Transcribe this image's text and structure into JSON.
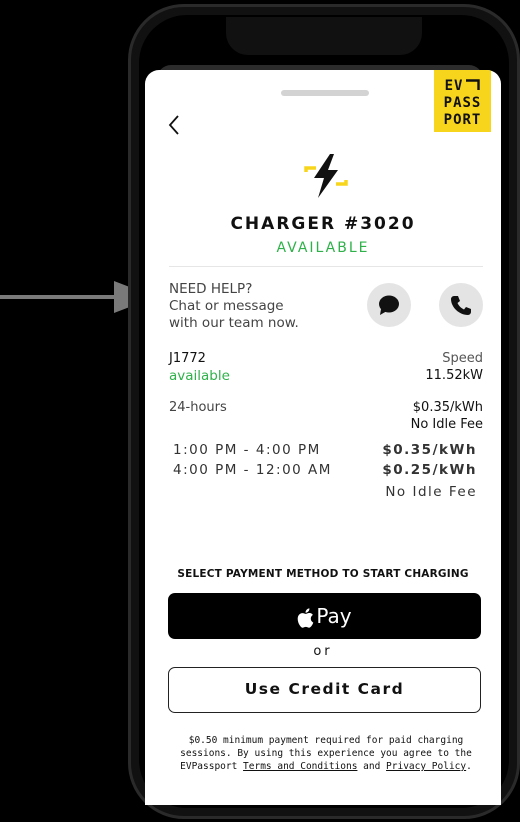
{
  "app": {
    "logo_line1": "EV",
    "logo_line2": "PASS",
    "logo_line3": "PORT",
    "accent_color": "#f7d51d",
    "status_color": "#2fb14a"
  },
  "nav": {
    "back_icon": "chevron-left-icon"
  },
  "charger": {
    "title": "CHARGER #3020",
    "status": "AVAILABLE",
    "icon": "lightning-bolt-icon"
  },
  "help": {
    "line1": "NEED HELP?",
    "line2": "Chat or message",
    "line3": "with our team now.",
    "chat_icon": "chat-bubble-icon",
    "phone_icon": "phone-icon"
  },
  "details": {
    "plug_type": "J1772",
    "plug_status": "available",
    "speed_label": "Speed",
    "speed_value": "11.52kW",
    "hours": "24-hours",
    "price": "$0.35/kWh",
    "idle_fee": "No Idle Fee"
  },
  "time_of_use": {
    "time1": "1:00 PM - 4:00 PM",
    "price1": "$0.35/kWh",
    "time2": "4:00 PM - 12:00 AM",
    "price2": "$0.25/kWh",
    "idle_fee": "No Idle Fee"
  },
  "payment": {
    "heading": "SELECT PAYMENT METHOD TO START CHARGING",
    "apple_pay_label": "Pay",
    "or_label": "or",
    "credit_card_label": "Use Credit Card"
  },
  "disclaimer": {
    "text1": "$0.50 minimum payment required for paid charging sessions. By using this experience you agree to the EVPassport ",
    "terms_link": "Terms and Conditions",
    "and": " and ",
    "privacy_link": "Privacy Policy",
    "end": "."
  }
}
